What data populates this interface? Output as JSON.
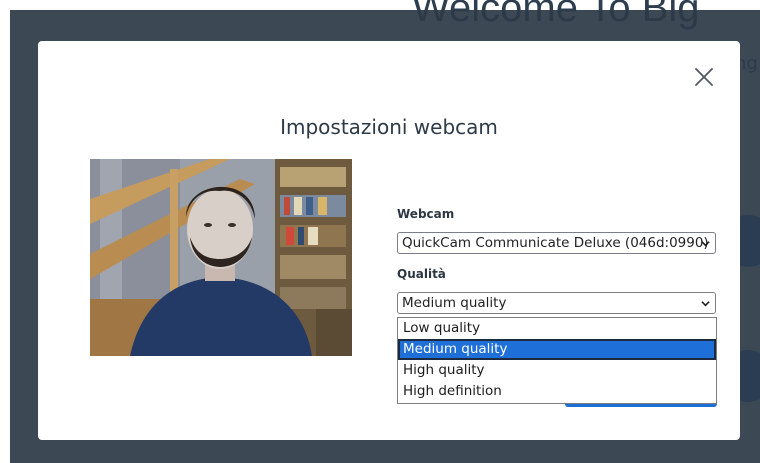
{
  "background": {
    "heading": "Welcome To Big",
    "subtext": "ng"
  },
  "modal": {
    "title": "Impostazioni webcam",
    "close_icon": "close-icon",
    "webcam": {
      "label": "Webcam",
      "selected": "QuickCam Communicate Deluxe (046d:0990)"
    },
    "quality": {
      "label": "Qualità",
      "selected": "Medium quality",
      "options": [
        "Low quality",
        "Medium quality",
        "High quality",
        "High definition"
      ]
    }
  },
  "colors": {
    "accent": "#1f6ed4",
    "overlay": "#2c3847",
    "selected_option": "#1f6fd9"
  }
}
